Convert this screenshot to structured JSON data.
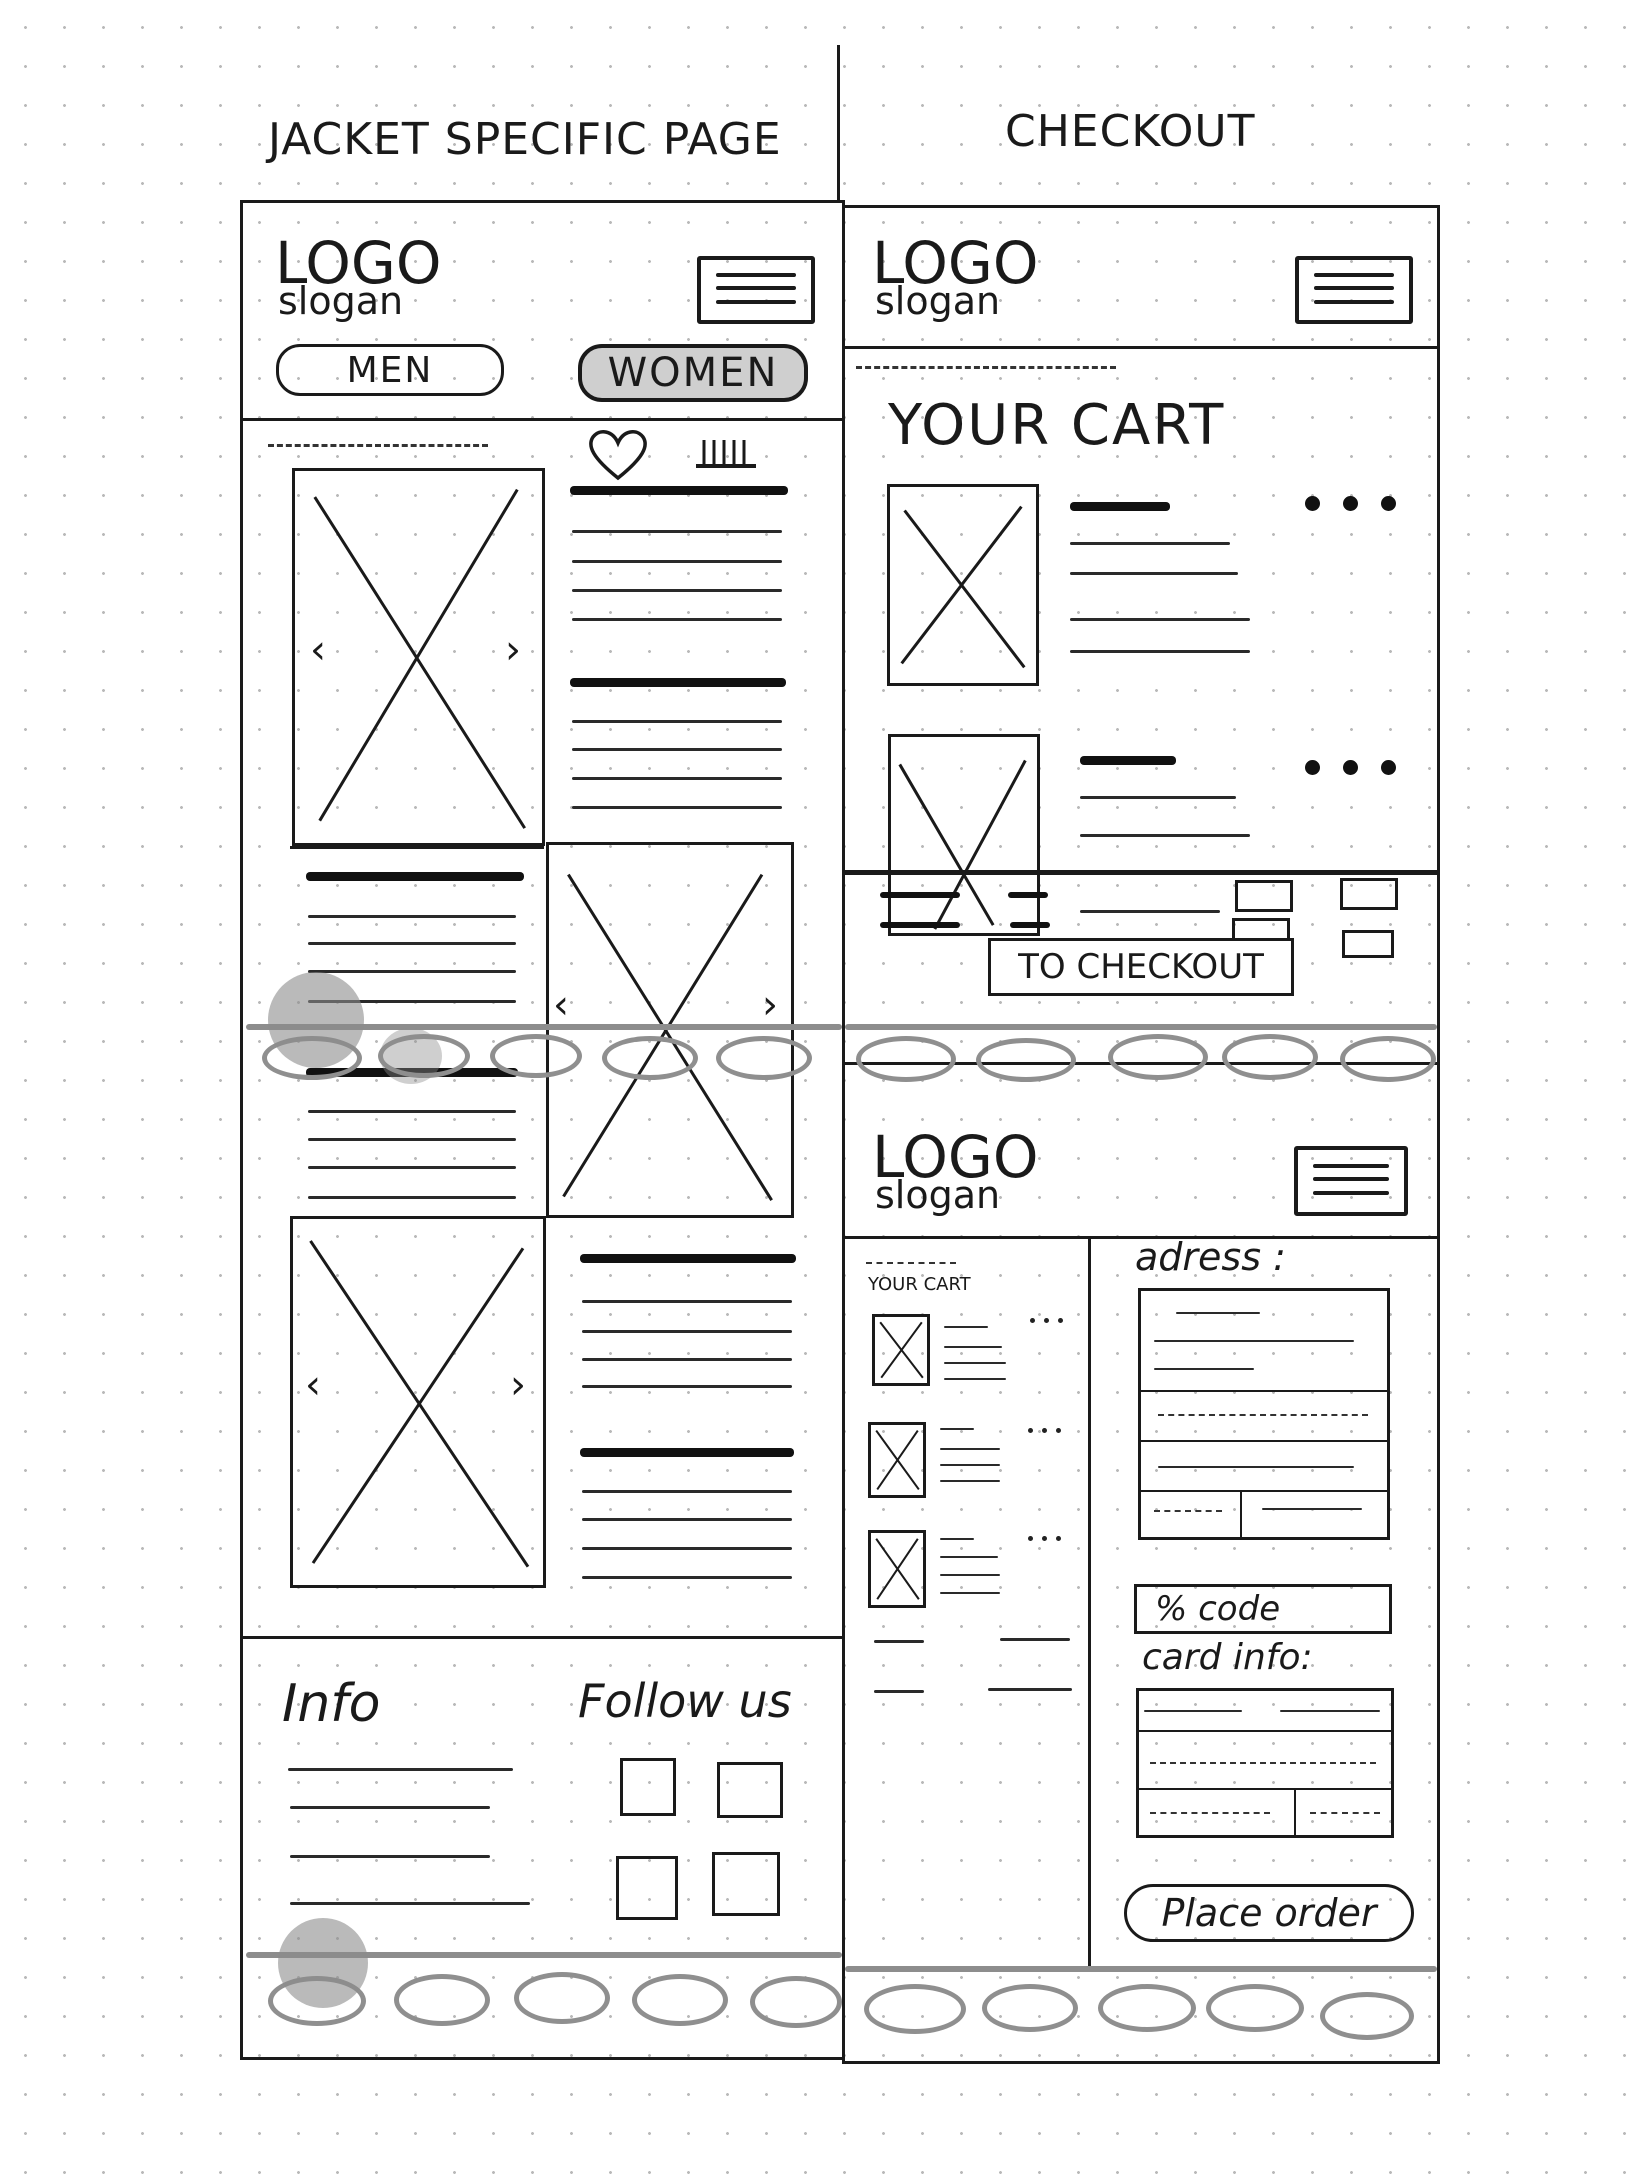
{
  "columns": {
    "left_heading": "JACKET SPECIFIC PAGE",
    "right_heading": "CHECKOUT"
  },
  "header": {
    "logo": "LOGO",
    "slogan": "slogan"
  },
  "nav": {
    "men": "MEN",
    "women": "WOMEN"
  },
  "cart": {
    "title": "YOUR CART",
    "small_title": "YOUR CART",
    "to_checkout": "TO CHECKOUT"
  },
  "checkout_form": {
    "address_label": "adress :",
    "code_label": "% code",
    "card_label": "card info:",
    "place_order": "Place order"
  },
  "footer": {
    "info": "Info",
    "follow": "Follow us"
  },
  "icons": {
    "heart": "heart-icon",
    "size": "ruler-icon",
    "menu": "hamburger-menu-icon",
    "image": "image-placeholder-icon"
  },
  "colors": {
    "ink": "#1a1a1a",
    "gray_nav": "#8f8f8f",
    "women_fill": "#cfcfcf"
  }
}
